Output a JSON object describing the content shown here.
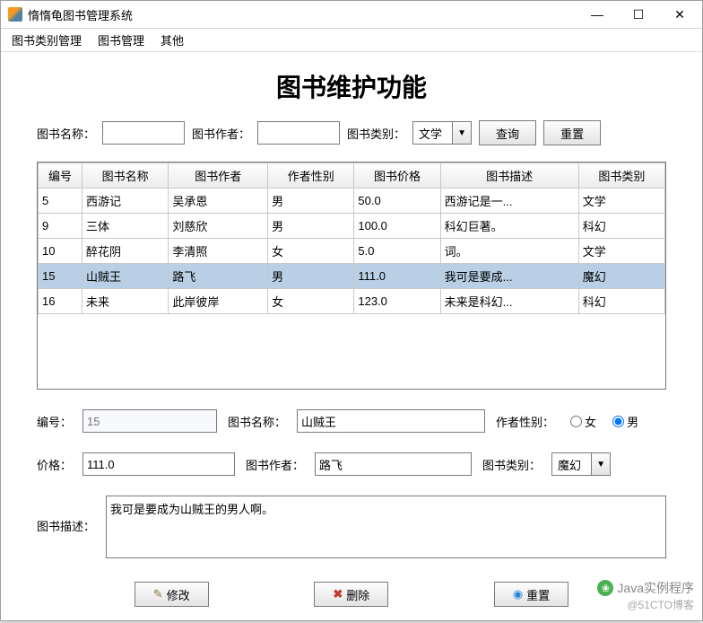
{
  "window": {
    "title": "惰惰龟图书管理系统"
  },
  "window_controls": {
    "min": "—",
    "max": "☐",
    "close": "✕"
  },
  "menu": {
    "category_mgmt": "图书类别管理",
    "book_mgmt": "图书管理",
    "other": "其他"
  },
  "page_title": "图书维护功能",
  "search": {
    "name_label": "图书名称：",
    "author_label": "图书作者：",
    "category_label": "图书类别：",
    "category_value": "文学",
    "query_btn": "查询",
    "reset_btn": "重置"
  },
  "table": {
    "headers": [
      "编号",
      "图书名称",
      "图书作者",
      "作者性别",
      "图书价格",
      "图书描述",
      "图书类别"
    ],
    "rows": [
      {
        "id": "5",
        "name": "西游记",
        "author": "吴承恩",
        "gender": "男",
        "price": "50.0",
        "desc": "西游记是一...",
        "cat": "文学",
        "selected": false
      },
      {
        "id": "9",
        "name": "三体",
        "author": "刘慈欣",
        "gender": "男",
        "price": "100.0",
        "desc": "科幻巨著。",
        "cat": "科幻",
        "selected": false
      },
      {
        "id": "10",
        "name": "醉花阴",
        "author": "李清照",
        "gender": "女",
        "price": "5.0",
        "desc": "词。",
        "cat": "文学",
        "selected": false
      },
      {
        "id": "15",
        "name": "山贼王",
        "author": "路飞",
        "gender": "男",
        "price": "111.0",
        "desc": "我可是要成...",
        "cat": "魔幻",
        "selected": true
      },
      {
        "id": "16",
        "name": "未来",
        "author": "此岸彼岸",
        "gender": "女",
        "price": "123.0",
        "desc": "未来是科幻...",
        "cat": "科幻",
        "selected": false
      }
    ]
  },
  "form": {
    "id_label": "编号：",
    "id_value": "15",
    "name_label": "图书名称：",
    "name_value": "山贼王",
    "gender_label": "作者性别：",
    "gender_female": "女",
    "gender_male": "男",
    "price_label": "价格：",
    "price_value": "111.0",
    "author_label": "图书作者：",
    "author_value": "路飞",
    "cat_label": "图书类别：",
    "cat_value": "魔幻",
    "desc_label": "图书描述：",
    "desc_value": "我可是要成为山贼王的男人啊。"
  },
  "actions": {
    "edit": "修改",
    "delete": "删除",
    "reset": "重置"
  },
  "watermark": {
    "line1": "Java实例程序",
    "line2": "@51CTO博客"
  }
}
